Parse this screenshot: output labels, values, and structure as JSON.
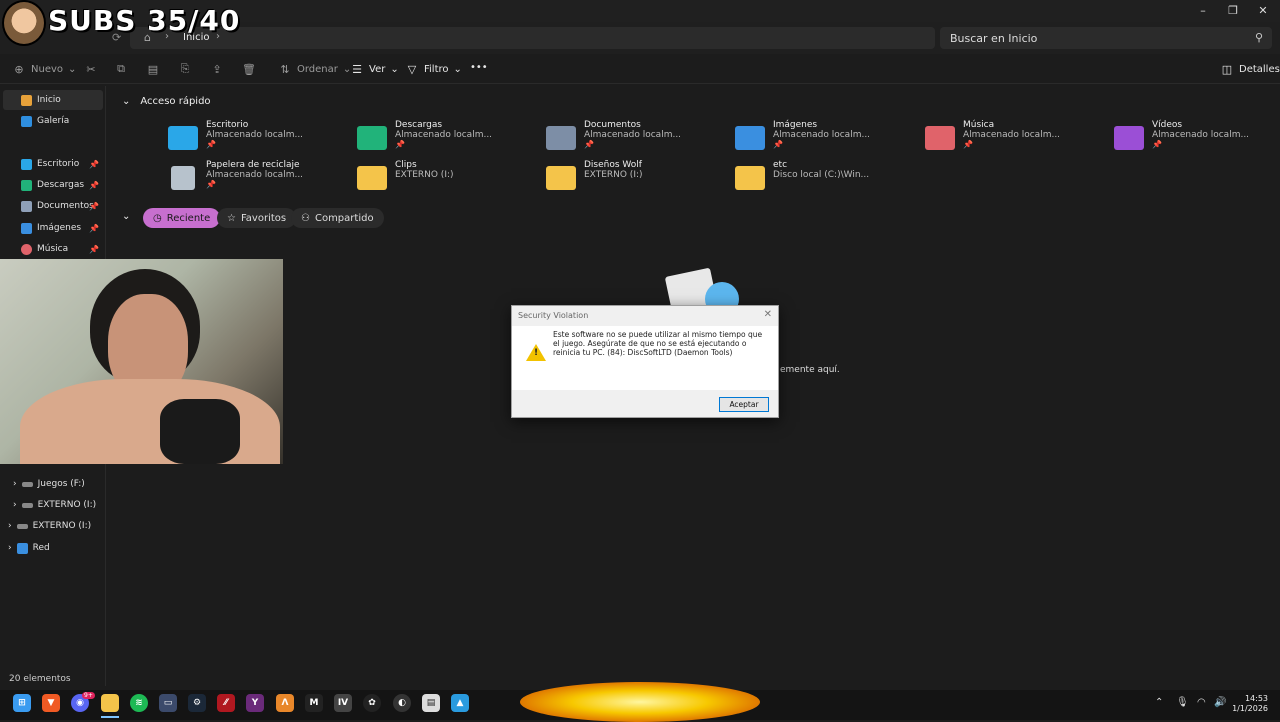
{
  "overlay": {
    "subs": "SUBS 35/40"
  },
  "window": {
    "controls": {
      "minimize": "–",
      "maximize": "❐",
      "close": "✕"
    }
  },
  "address": {
    "crumb": "Inicio",
    "search_placeholder": "Buscar en Inicio"
  },
  "toolbar": {
    "new": "Nuevo",
    "sort": "Ordenar",
    "view": "Ver",
    "filter": "Filtro",
    "more": "•••",
    "details": "Detalles"
  },
  "sidebar": {
    "top": [
      {
        "label": "Inicio"
      },
      {
        "label": "Galería"
      }
    ],
    "pinned": [
      {
        "label": "Escritorio"
      },
      {
        "label": "Descargas"
      },
      {
        "label": "Documentos"
      },
      {
        "label": "Imágenes"
      },
      {
        "label": "Música"
      }
    ],
    "drives": [
      {
        "label": "Juegos (F:)"
      },
      {
        "label": "EXTERNO (I:)"
      }
    ],
    "roots": [
      {
        "label": "EXTERNO (I:)"
      },
      {
        "label": "Red"
      }
    ]
  },
  "quick_access": {
    "title": "Acceso rápido",
    "items": [
      {
        "name": "Escritorio",
        "sub": "Almacenado localm...",
        "color": "#2aa7e8"
      },
      {
        "name": "Descargas",
        "sub": "Almacenado localm...",
        "color": "#21b37a"
      },
      {
        "name": "Documentos",
        "sub": "Almacenado localm...",
        "color": "#7d8ea6"
      },
      {
        "name": "Imágenes",
        "sub": "Almacenado localm...",
        "color": "#3a8fe0"
      },
      {
        "name": "Música",
        "sub": "Almacenado localm...",
        "color": "#e0636a"
      },
      {
        "name": "Vídeos",
        "sub": "Almacenado localm...",
        "color": "#9b4fd6"
      },
      {
        "name": "Papelera de reciclaje",
        "sub": "Almacenado localm...",
        "color": "#b7c2cc"
      },
      {
        "name": "Clips",
        "sub": "EXTERNO (I:)",
        "color": "#f4c44a"
      },
      {
        "name": "Diseños Wolf",
        "sub": "EXTERNO (I:)",
        "color": "#f4c44a"
      },
      {
        "name": "etc",
        "sub": "Disco local (C:)\\Win...",
        "color": "#f4c44a"
      }
    ]
  },
  "chips": {
    "recent": "Reciente",
    "favorites": "Favoritos",
    "shared": "Compartido"
  },
  "empty_hint": "emente aquí.",
  "dialog": {
    "title": "Security Violation",
    "message": "Este software no se puede utilizar al mismo tiempo que el juego. Asegúrate de que no se está ejecutando o reinicia tu PC. (84): DiscSoftLTD (Daemon Tools)",
    "ok": "Aceptar"
  },
  "status": {
    "count": "20 elementos"
  },
  "taskbar": {
    "time": "14:53",
    "date": "1/1/2026",
    "badge": "9+"
  }
}
